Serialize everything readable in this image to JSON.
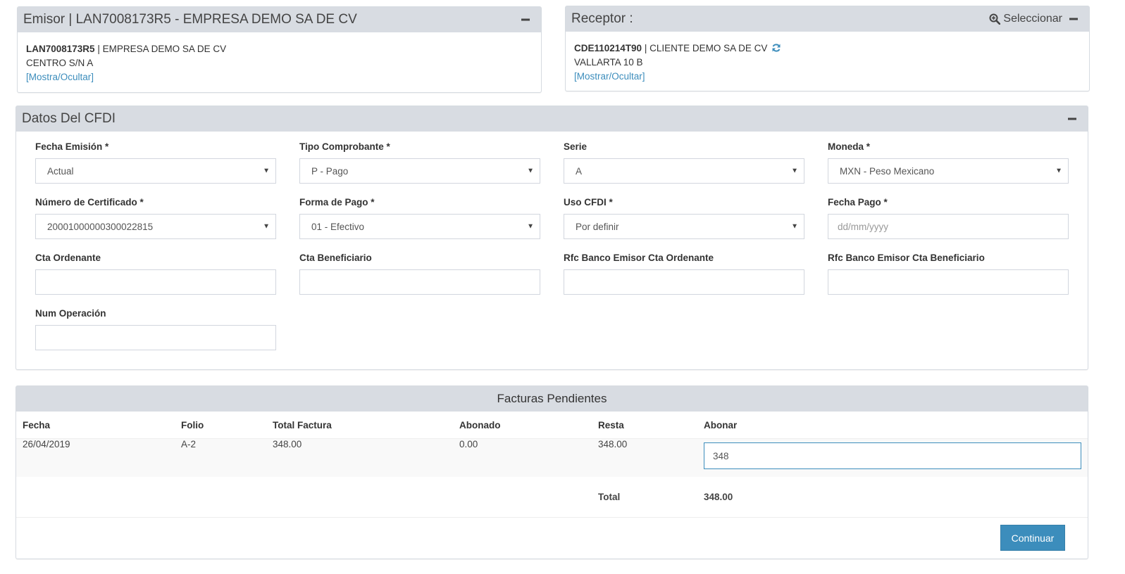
{
  "emisor": {
    "title": "Emisor | LAN7008173R5 - EMPRESA DEMO SA DE CV",
    "rfc": "LAN7008173R5",
    "name_sep": " | EMPRESA DEMO SA DE CV",
    "address": "CENTRO S/N A",
    "toggle_link": "[Mostra/Ocultar]"
  },
  "receptor": {
    "title": "Receptor :",
    "select_label": "Seleccionar",
    "rfc": "CDE110214T90",
    "name_sep": " | CLIENTE DEMO SA DE CV",
    "address": "VALLARTA 10 B",
    "toggle_link": "[Mostrar/Ocultar]"
  },
  "cfdi": {
    "title": "Datos Del CFDI",
    "fields": {
      "fecha_emision": {
        "label": "Fecha Emisión *",
        "value": "Actual"
      },
      "tipo_comprobante": {
        "label": "Tipo Comprobante *",
        "value": "P - Pago"
      },
      "serie": {
        "label": "Serie",
        "value": "A"
      },
      "moneda": {
        "label": "Moneda *",
        "value": "MXN - Peso Mexicano"
      },
      "numero_certificado": {
        "label": "Número de Certificado *",
        "value": "20001000000300022815"
      },
      "forma_pago": {
        "label": "Forma de Pago *",
        "value": "01 - Efectivo"
      },
      "uso_cfdi": {
        "label": "Uso CFDI *",
        "value": "Por definir"
      },
      "fecha_pago": {
        "label": "Fecha Pago *",
        "placeholder": "dd/mm/yyyy"
      },
      "cta_ordenante": {
        "label": "Cta Ordenante",
        "value": ""
      },
      "cta_beneficiario": {
        "label": "Cta Beneficiario",
        "value": ""
      },
      "rfc_banco_ordenante": {
        "label": "Rfc Banco Emisor Cta Ordenante",
        "value": ""
      },
      "rfc_banco_beneficiario": {
        "label": "Rfc Banco Emisor Cta Beneficiario",
        "value": ""
      },
      "num_operacion": {
        "label": "Num Operación",
        "value": ""
      }
    }
  },
  "facturas": {
    "title": "Facturas Pendientes",
    "columns": [
      "Fecha",
      "Folio",
      "Total Factura",
      "Abonado",
      "Resta",
      "Abonar"
    ],
    "rows": [
      {
        "fecha": "26/04/2019",
        "folio": "A-2",
        "total": "348.00",
        "abonado": "0.00",
        "resta": "348.00",
        "abonar": "348"
      }
    ],
    "total_label": "Total",
    "total_value": "348.00",
    "continue_label": "Continuar"
  },
  "colors": {
    "accent": "#3c8dbc",
    "header_bg": "#d8dce2"
  },
  "icons": [
    "collapse-icon",
    "search-plus-icon",
    "refresh-icon",
    "caret-down-icon"
  ]
}
